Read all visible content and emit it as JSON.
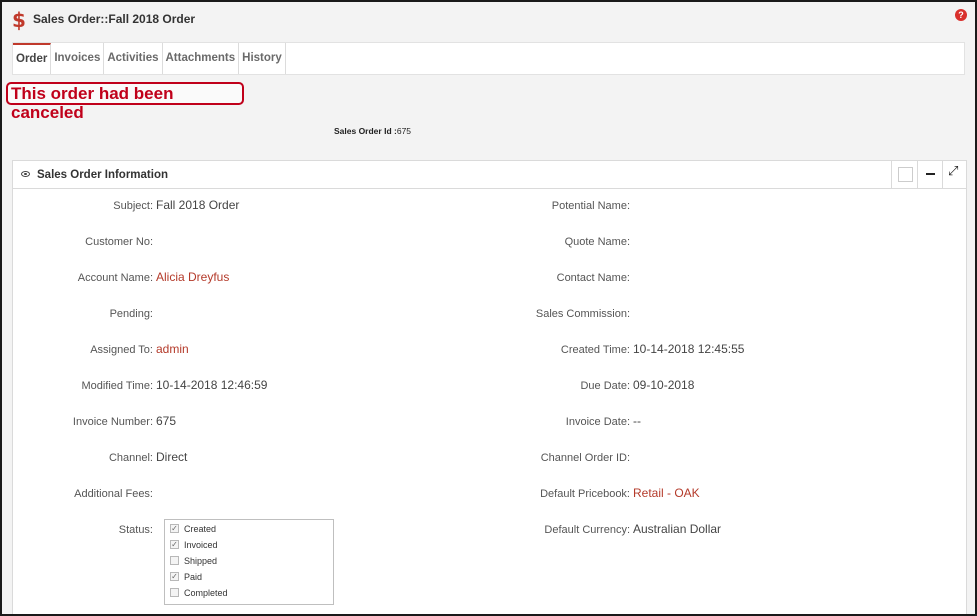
{
  "header": {
    "title": "Sales Order::Fall 2018 Order",
    "currency_icon": "$",
    "help_icon": "?"
  },
  "tabs": [
    "Order",
    "Invoices",
    "Activities",
    "Attachments",
    "History"
  ],
  "banner": {
    "text": "This order had been canceled"
  },
  "sales_order_id": {
    "label": "Sales Order Id :",
    "value": "675"
  },
  "panel": {
    "title": "Sales Order Information",
    "left": [
      {
        "label": "Subject:",
        "value": "Fall 2018 Order",
        "link": false
      },
      {
        "label": "Customer No:",
        "value": "",
        "link": false
      },
      {
        "label": "Account Name:",
        "value": "Alicia Dreyfus",
        "link": true
      },
      {
        "label": "Pending:",
        "value": "",
        "link": false
      },
      {
        "label": "Assigned To:",
        "value": "admin",
        "link": true
      },
      {
        "label": "Modified Time:",
        "value": "10-14-2018 12:46:59",
        "link": false
      },
      {
        "label": "Invoice Number:",
        "value": "675",
        "link": false
      },
      {
        "label": "Channel:",
        "value": "Direct",
        "link": false
      },
      {
        "label": "Additional Fees:",
        "value": "",
        "link": false
      },
      {
        "label": "Status:",
        "value": "",
        "link": false
      }
    ],
    "right": [
      {
        "label": "Potential Name:",
        "value": "",
        "link": false
      },
      {
        "label": "Quote Name:",
        "value": "",
        "link": false
      },
      {
        "label": "Contact Name:",
        "value": "",
        "link": false
      },
      {
        "label": "Sales Commission:",
        "value": "",
        "link": false
      },
      {
        "label": "Created Time:",
        "value": "10-14-2018 12:45:55",
        "link": false
      },
      {
        "label": "Due Date:",
        "value": "09-10-2018",
        "link": false
      },
      {
        "label": "Invoice Date:",
        "value": "--",
        "link": false
      },
      {
        "label": "Channel Order ID:",
        "value": "",
        "link": false
      },
      {
        "label": "Default Pricebook:",
        "value": "Retail - OAK",
        "link": true
      },
      {
        "label": "Default Currency:",
        "value": "Australian Dollar",
        "link": false
      }
    ],
    "status_options": [
      {
        "label": "Created",
        "checked": true
      },
      {
        "label": "Invoiced",
        "checked": true
      },
      {
        "label": "Shipped",
        "checked": false
      },
      {
        "label": "Paid",
        "checked": true
      },
      {
        "label": "Completed",
        "checked": false
      }
    ]
  },
  "colors": {
    "accent": "#c0392b",
    "banner": "#c0001a",
    "link": "#b43a2a"
  }
}
